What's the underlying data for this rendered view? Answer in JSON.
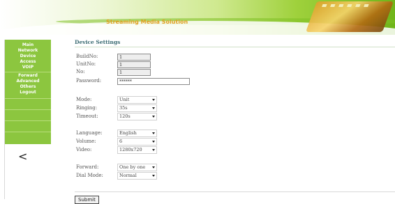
{
  "header": {
    "title": "Streaming Media Solution"
  },
  "sidebar": {
    "items": [
      {
        "label": "Main"
      },
      {
        "label": "Network"
      },
      {
        "label": "Device"
      },
      {
        "label": "Access"
      },
      {
        "label": "VOIP"
      },
      {
        "label": "Forward"
      },
      {
        "label": "Advanced"
      },
      {
        "label": "Others"
      },
      {
        "label": "Logout"
      }
    ],
    "back_glyph": "<"
  },
  "main": {
    "title": "Device Settings",
    "fields": {
      "build_no": {
        "label": "BuildNo:",
        "value": "1"
      },
      "unit_no": {
        "label": "UnitNo:",
        "value": "1"
      },
      "no": {
        "label": "No:",
        "value": "1"
      },
      "password": {
        "label": "Password:",
        "value": "******"
      },
      "mode": {
        "label": "Mode:",
        "value": "Unit"
      },
      "ringing": {
        "label": "Ringing:",
        "value": "35s"
      },
      "timeout": {
        "label": "Timeout:",
        "value": "120s"
      },
      "language": {
        "label": "Language:",
        "value": "English"
      },
      "volume": {
        "label": "Volume:",
        "value": "6"
      },
      "video": {
        "label": "Video:",
        "value": "1280x720"
      },
      "forward": {
        "label": "Forward:",
        "value": "One by one"
      },
      "dial_mode": {
        "label": "Dial Mode:",
        "value": "Normal"
      }
    },
    "submit_label": "Submit"
  },
  "colors": {
    "menu_green": "#8cc63f",
    "title_accent": "#e0a020",
    "heading_teal": "#3b6b73"
  },
  "icons": {
    "back": "chevron-left-icon",
    "select_arrow": "caret-down-icon"
  }
}
